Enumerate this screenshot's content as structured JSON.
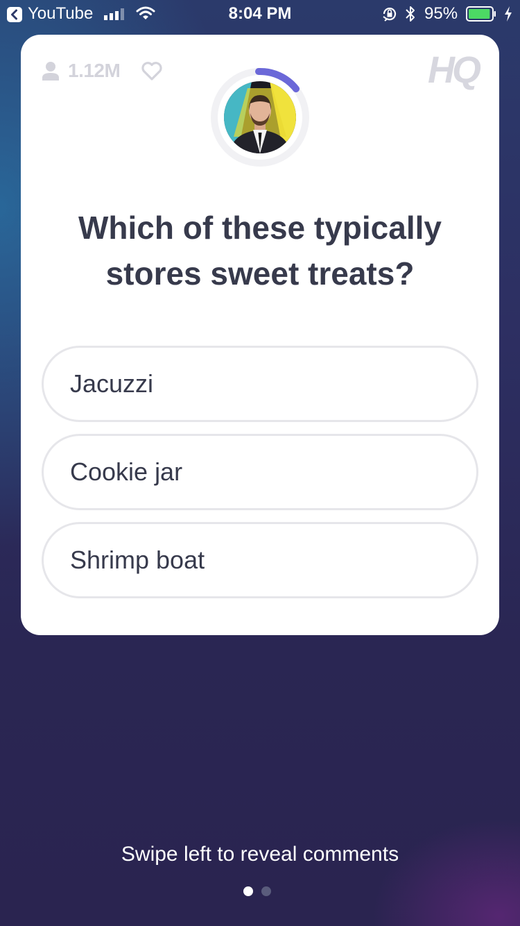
{
  "status_bar": {
    "back_app": "YouTube",
    "time": "8:04 PM",
    "battery_percent": "95%",
    "battery_level": 0.95,
    "icons": [
      "back-icon",
      "cellular-signal-icon",
      "wifi-icon",
      "orientation-lock-icon",
      "bluetooth-icon",
      "battery-icon",
      "charging-bolt-icon"
    ]
  },
  "header": {
    "viewer_count": "1.12M",
    "logo": "HQ",
    "icons": [
      "person-icon",
      "heart-icon"
    ]
  },
  "question": {
    "text": "Which of these typically stores sweet treats?"
  },
  "answers": [
    {
      "label": "Jacuzzi"
    },
    {
      "label": "Cookie jar"
    },
    {
      "label": "Shrimp boat"
    }
  ],
  "footer": {
    "hint": "Swipe left to reveal comments",
    "page_count": 2,
    "active_page": 1
  },
  "colors": {
    "timer_accent": "#6b68d8",
    "text_dark": "#373a4c",
    "muted": "#d3d3db"
  }
}
